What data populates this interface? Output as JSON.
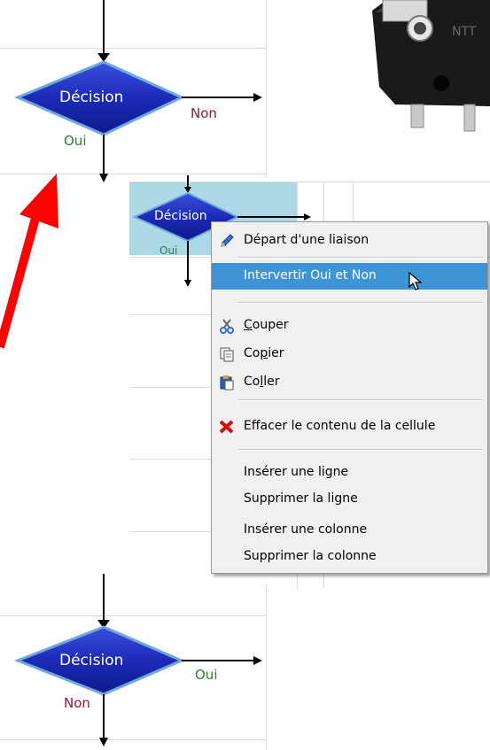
{
  "flowcharts": {
    "top": {
      "decision_label": "Décision",
      "right_label": "Non",
      "bottom_label": "Oui"
    },
    "middle": {
      "decision_label": "Décision",
      "bottom_label": "Oui"
    },
    "bottom": {
      "decision_label": "Décision",
      "right_label": "Oui",
      "bottom_label": "Non"
    }
  },
  "context_menu": {
    "items": [
      {
        "label": "Départ d'une liaison",
        "icon": "pencil-icon"
      },
      {
        "label": "Intervertir Oui et Non",
        "highlighted": true
      },
      {
        "label": "Couper",
        "accel": "C",
        "rest": "ouper",
        "icon": "scissors-icon"
      },
      {
        "label": "Copier",
        "pre": "Co",
        "accel": "p",
        "rest": "ier",
        "icon": "copy-icon"
      },
      {
        "label": "Coller",
        "pre": "Co",
        "accel": "l",
        "rest": "ler",
        "icon": "paste-icon"
      },
      {
        "label": "Effacer le contenu de la cellule",
        "icon": "delete-x-icon"
      },
      {
        "label": "Insérer une ligne"
      },
      {
        "label": "Supprimer la ligne"
      },
      {
        "label": "Insérer une colonne"
      },
      {
        "label": "Supprimer la colonne"
      }
    ]
  },
  "colors": {
    "diamond_fill": "#1f2fbf",
    "diamond_edge": "#5a9bd5",
    "oui_color": "#2e7d32",
    "non_color": "#8b1a3a",
    "arrow_red": "#ff0000",
    "selection": "#add8e6",
    "menu_highlight": "#3d95d8"
  },
  "photo": {
    "subject": "micro-switch component"
  }
}
